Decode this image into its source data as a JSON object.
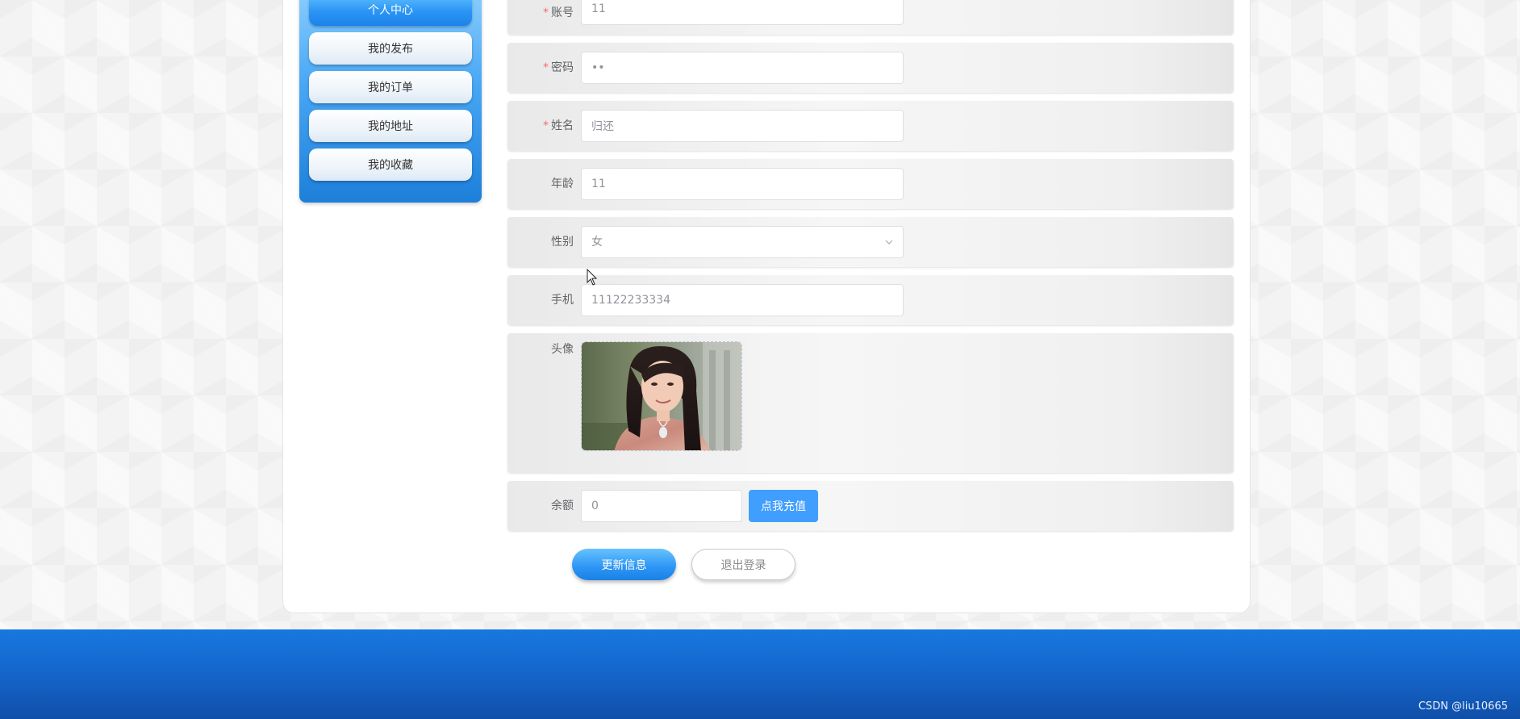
{
  "sidebar": {
    "items": [
      {
        "label": "个人中心",
        "active": true
      },
      {
        "label": "我的发布",
        "active": false
      },
      {
        "label": "我的订单",
        "active": false
      },
      {
        "label": "我的地址",
        "active": false
      },
      {
        "label": "我的收藏",
        "active": false
      }
    ]
  },
  "form": {
    "account": {
      "label": "账号",
      "value": "11",
      "required": true
    },
    "password": {
      "label": "密码",
      "value": "••",
      "required": true
    },
    "name": {
      "label": "姓名",
      "value": "归还",
      "required": true
    },
    "age": {
      "label": "年龄",
      "value": "11",
      "required": false
    },
    "gender": {
      "label": "性别",
      "value": "女",
      "required": false
    },
    "phone": {
      "label": "手机",
      "value": "11122233334",
      "required": false
    },
    "avatar": {
      "label": "头像"
    },
    "balance": {
      "label": "余额",
      "value": "0",
      "required": false,
      "recharge_label": "点我充值"
    }
  },
  "actions": {
    "update_label": "更新信息",
    "logout_label": "退出登录"
  },
  "footer": {
    "watermark": "CSDN @liu10665"
  },
  "colors": {
    "accent": "#409eff",
    "required": "#f56c6c",
    "footer": "#1463c8"
  }
}
